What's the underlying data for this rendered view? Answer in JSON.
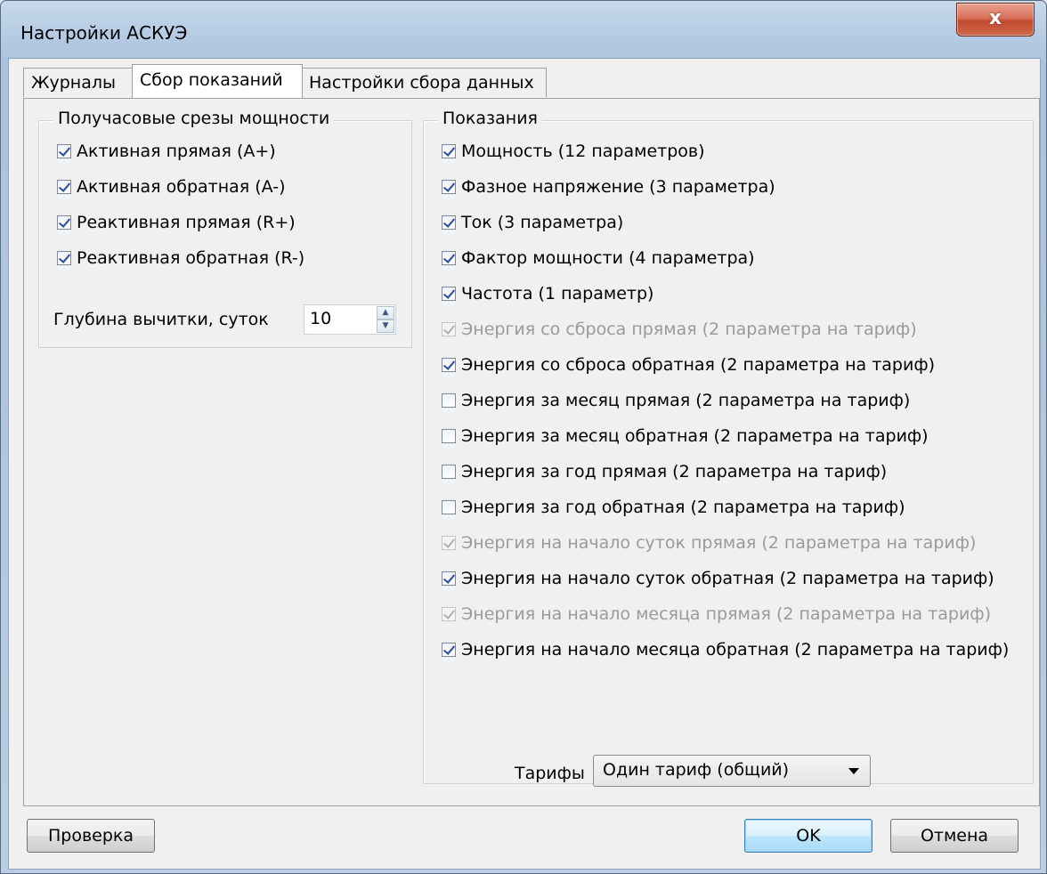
{
  "window": {
    "title": "Настройки АСКУЭ",
    "close_glyph": "x"
  },
  "tabs": [
    {
      "label": "Журналы",
      "active": false
    },
    {
      "label": "Сбор показаний",
      "active": true
    },
    {
      "label": "Настройки сбора данных",
      "active": false
    }
  ],
  "left_group": {
    "title": "Получасовые срезы мощности",
    "items": [
      {
        "label": "Активная прямая (A+)",
        "checked": true
      },
      {
        "label": "Активная обратная (A-)",
        "checked": true
      },
      {
        "label": "Реактивная прямая (R+)",
        "checked": true
      },
      {
        "label": "Реактивная обратная (R-)",
        "checked": true
      }
    ],
    "depth_label": "Глубина вычитки, суток",
    "depth_value": "10"
  },
  "right_group": {
    "title": "Показания",
    "items": [
      {
        "label": "Мощность (12 параметров)",
        "checked": true,
        "disabled": false
      },
      {
        "label": "Фазное напряжение (3 параметра)",
        "checked": true,
        "disabled": false
      },
      {
        "label": "Ток (3 параметра)",
        "checked": true,
        "disabled": false
      },
      {
        "label": "Фактор мощности (4 параметра)",
        "checked": true,
        "disabled": false
      },
      {
        "label": "Частота (1 параметр)",
        "checked": true,
        "disabled": false
      },
      {
        "label": "Энергия со сброса прямая (2 параметра на тариф)",
        "checked": true,
        "disabled": true
      },
      {
        "label": "Энергия со сброса обратная (2 параметра на тариф)",
        "checked": true,
        "disabled": false
      },
      {
        "label": "Энергия за месяц прямая (2 параметра на тариф)",
        "checked": false,
        "disabled": false
      },
      {
        "label": "Энергия за месяц обратная (2 параметра на тариф)",
        "checked": false,
        "disabled": false
      },
      {
        "label": "Энергия за год прямая (2 параметра на тариф)",
        "checked": false,
        "disabled": false
      },
      {
        "label": "Энергия за год обратная (2 параметра на тариф)",
        "checked": false,
        "disabled": false
      },
      {
        "label": "Энергия на начало суток прямая (2 параметра на тариф)",
        "checked": true,
        "disabled": true
      },
      {
        "label": "Энергия на начало суток обратная (2 параметра на тариф)",
        "checked": true,
        "disabled": false
      },
      {
        "label": "Энергия на начало месяца прямая (2 параметра на тариф)",
        "checked": true,
        "disabled": true
      },
      {
        "label": "Энергия на начало месяца обратная (2 параметра на тариф)",
        "checked": true,
        "disabled": false
      }
    ],
    "tariff_label": "Тарифы",
    "tariff_value": "Один тариф (общий)"
  },
  "buttons": {
    "check": "Проверка",
    "ok": "OK",
    "cancel": "Отмена"
  }
}
